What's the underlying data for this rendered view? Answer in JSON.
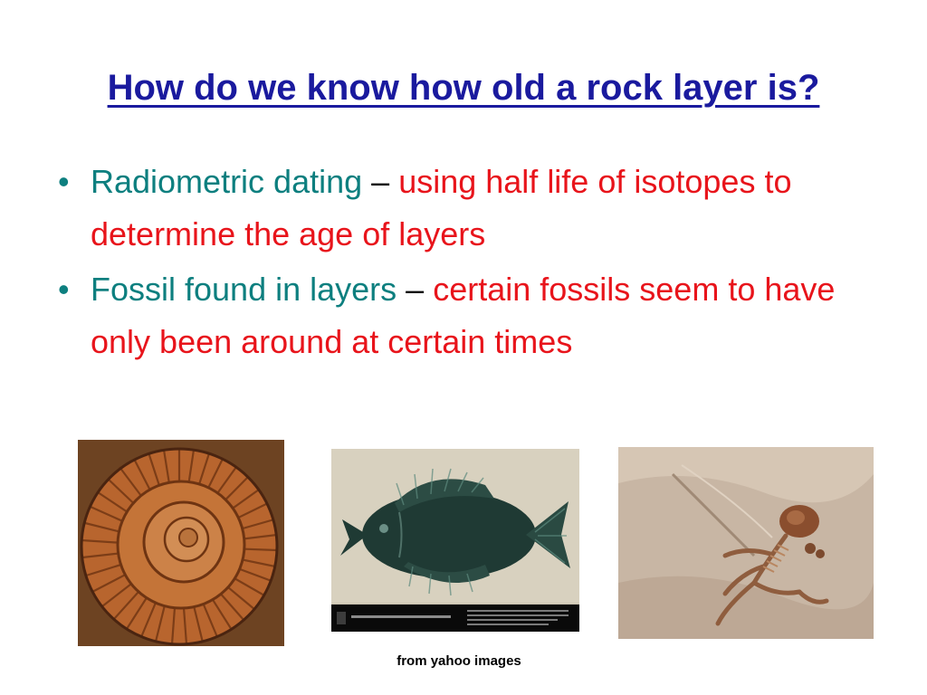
{
  "slide": {
    "title": "How do we know how old a rock layer is?",
    "bullets": [
      {
        "term": "Radiometric dating",
        "dash": "–",
        "definition": "using half life of isotopes to determine the age of layers"
      },
      {
        "term": "Fossil found in layers",
        "dash": "–",
        "definition": "certain fossils seem to have only been around at certain times"
      }
    ],
    "bullet_glyph": "•",
    "image_credit": "from yahoo images"
  },
  "colors": {
    "title": "#1a1a9e",
    "term": "#0d7f7f",
    "definition": "#e8141b"
  },
  "images": [
    {
      "name": "ammonite-fossil-photo"
    },
    {
      "name": "fish-fossil-photo"
    },
    {
      "name": "skeleton-fossil-photo"
    }
  ]
}
